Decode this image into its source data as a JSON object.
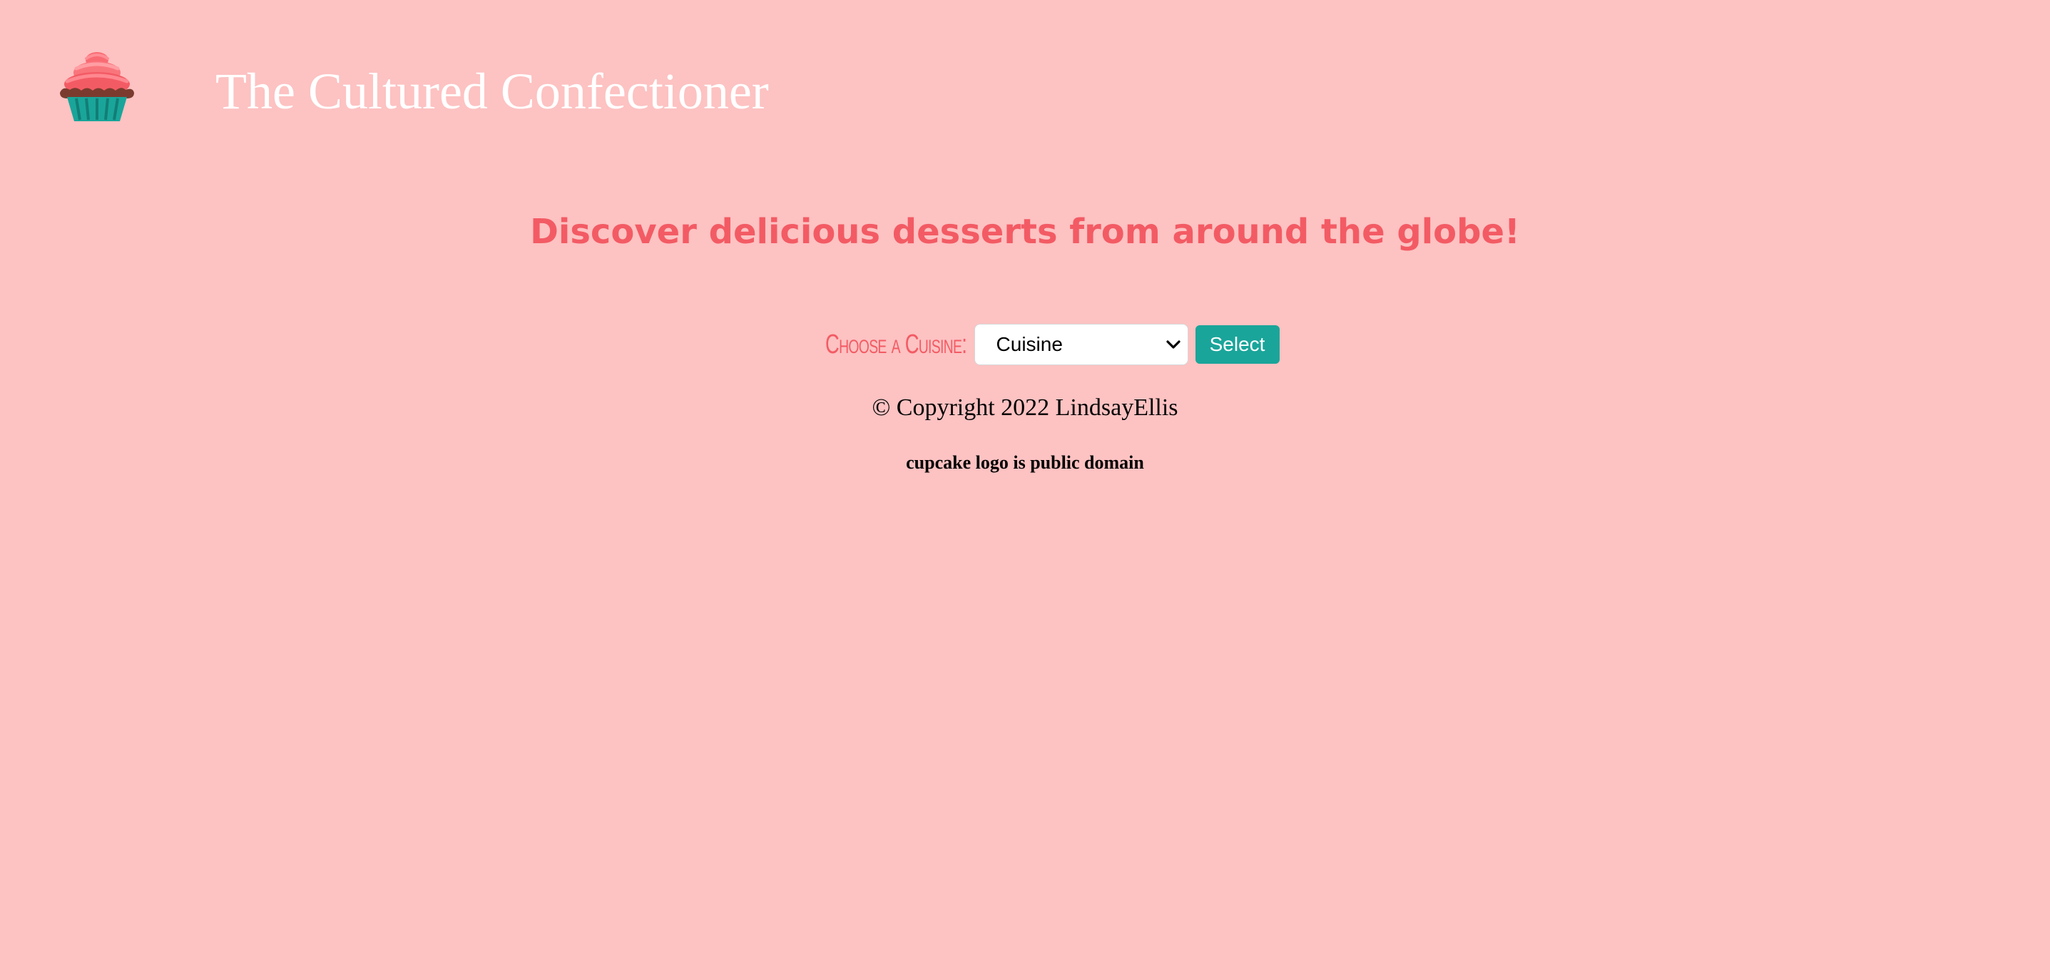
{
  "header": {
    "title": "The Cultured Confectioner",
    "logo_icon": "cupcake-icon"
  },
  "main": {
    "tagline": "Discover delicious desserts from around the globe!",
    "cuisine_form": {
      "label": "Choose a Cuisine:",
      "select_value": "Cuisine",
      "button_label": "Select"
    }
  },
  "footer": {
    "copyright": "© Copyright 2022 LindsayEllis",
    "credit": "cupcake logo is public domain"
  },
  "colors": {
    "background": "#fdc2c2",
    "accent": "#f35b64",
    "button": "#1aa59a",
    "title": "#ffffff"
  }
}
